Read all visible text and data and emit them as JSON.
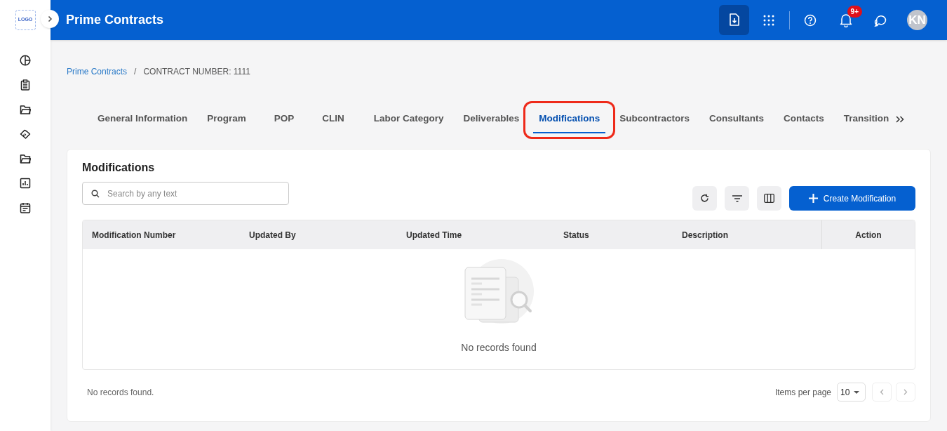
{
  "header": {
    "logo": "LOGO",
    "title": "Prime Contracts",
    "notification_badge": "9+",
    "avatar": "KN"
  },
  "breadcrumb": [
    "Prime Contracts",
    "CONTRACT NUMBER: 1111"
  ],
  "breadcrumb_separator": "/",
  "tabs": [
    {
      "label": "General Information",
      "selected": false,
      "highlighted": false
    },
    {
      "label": "Program",
      "selected": false,
      "highlighted": false
    },
    {
      "label": "POP",
      "selected": false,
      "highlighted": false
    },
    {
      "label": "CLIN",
      "selected": false,
      "highlighted": false
    },
    {
      "label": "Labor Category",
      "selected": false,
      "highlighted": false
    },
    {
      "label": "Deliverables",
      "selected": false,
      "highlighted": false
    },
    {
      "label": "Modifications",
      "selected": true,
      "highlighted": true
    },
    {
      "label": "Subcontractors",
      "selected": false,
      "highlighted": false
    },
    {
      "label": "Consultants",
      "selected": false,
      "highlighted": false
    },
    {
      "label": "Contacts",
      "selected": false,
      "highlighted": false
    },
    {
      "label": "Transition",
      "selected": false,
      "highlighted": false
    }
  ],
  "panel": {
    "title": "Modifications",
    "search": {
      "placeholder": "Search by any text"
    },
    "create_button": "Create Modification"
  },
  "table": {
    "columns": [
      "Modification Number",
      "Updated By",
      "Updated Time",
      "Status",
      "Description",
      "Action"
    ],
    "empty_message": "No records found"
  },
  "footer": {
    "summary": "No records found.",
    "items_per_page_label": "Items per page",
    "items_per_page": "10"
  }
}
